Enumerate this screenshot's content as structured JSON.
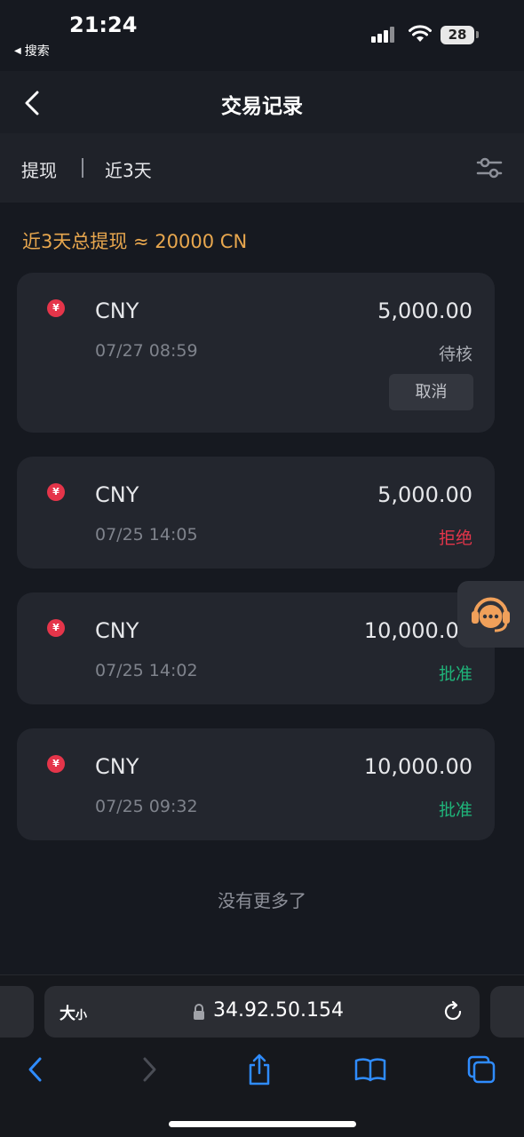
{
  "status_bar": {
    "time": "21:24",
    "back_app": "搜索",
    "battery": "28"
  },
  "header": {
    "title": "交易记录"
  },
  "filter": {
    "type": "提现",
    "range": "近3天"
  },
  "summary": "近3天总提现 ≈ 20000 CN",
  "transactions": [
    {
      "icon": "¥",
      "currency": "CNY",
      "amount": "5,000.00",
      "datetime": "07/27 08:59",
      "status": "待核",
      "action": "取消"
    },
    {
      "icon": "¥",
      "currency": "CNY",
      "amount": "5,000.00",
      "datetime": "07/25 14:05",
      "status": "拒绝"
    },
    {
      "icon": "¥",
      "currency": "CNY",
      "amount": "10,000.00",
      "datetime": "07/25 14:02",
      "status": "批准"
    },
    {
      "icon": "¥",
      "currency": "CNY",
      "amount": "10,000.00",
      "datetime": "07/25 09:32",
      "status": "批准"
    }
  ],
  "footer_note": "没有更多了",
  "browser": {
    "text_size": "大",
    "text_size_small": "小",
    "url": "34.92.50.154"
  },
  "colors": {
    "accent": "#e8a74e",
    "rejected": "#e5354a",
    "approved": "#1fb57a",
    "link_blue": "#2f8cff"
  },
  "icons": [
    "back-chevron-icon",
    "filter-sliders-icon",
    "yen-icon",
    "support-headset-icon",
    "lock-icon",
    "reload-icon",
    "share-icon",
    "bookmarks-icon",
    "tabs-icon"
  ]
}
